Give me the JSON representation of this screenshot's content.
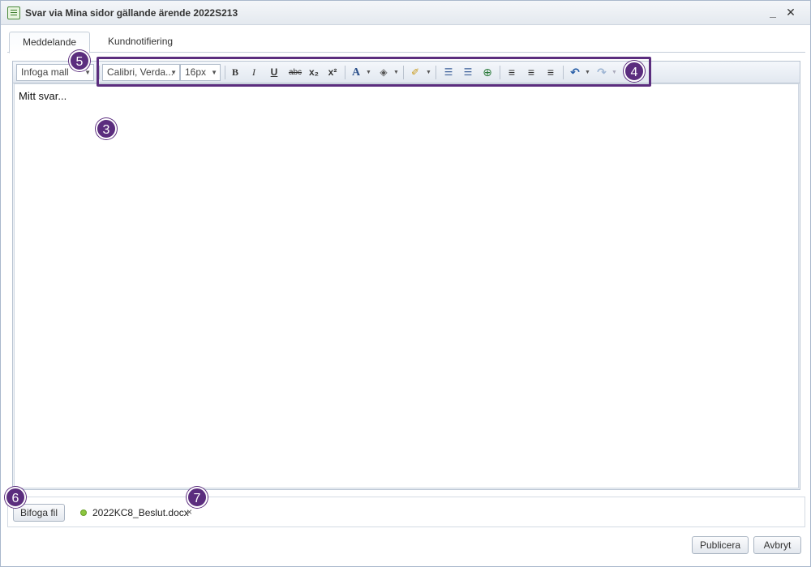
{
  "window": {
    "title": "Svar via Mina sidor gällande ärende 2022S213",
    "minimize_label": "_",
    "close_label": "✕"
  },
  "tabs": [
    {
      "label": "Meddelande",
      "active": true
    },
    {
      "label": "Kundnotifiering",
      "active": false
    }
  ],
  "toolbar": {
    "template_dropdown": "Infoga mall",
    "font_family": "Calibri, Verda...",
    "font_size": "16px",
    "bold": "B",
    "italic": "I",
    "underline": "U",
    "strikethrough": "abc",
    "subscript": "x₂",
    "superscript": "x²",
    "font_color": "A",
    "highlight_color": "◈",
    "clear_format": "✐",
    "bullet_list": "☰",
    "numbered_list": "☰",
    "insert_link": "⊕",
    "align_left": "≡",
    "align_center": "≡",
    "align_right": "≡",
    "undo": "↶",
    "redo": "↷"
  },
  "editor": {
    "content": "Mitt svar..."
  },
  "attachments": {
    "attach_button": "Bifoga fil",
    "files": [
      {
        "name": "2022KC8_Beslut.docx",
        "remove": "×"
      }
    ]
  },
  "footer": {
    "publish_button": "Publicera",
    "cancel_button": "Avbryt"
  },
  "callouts": {
    "c3": "3",
    "c4": "4",
    "c5": "5",
    "c6": "6",
    "c7": "7"
  },
  "colors": {
    "callout": "#5b2d7e",
    "file_status": "#8cc63f"
  }
}
